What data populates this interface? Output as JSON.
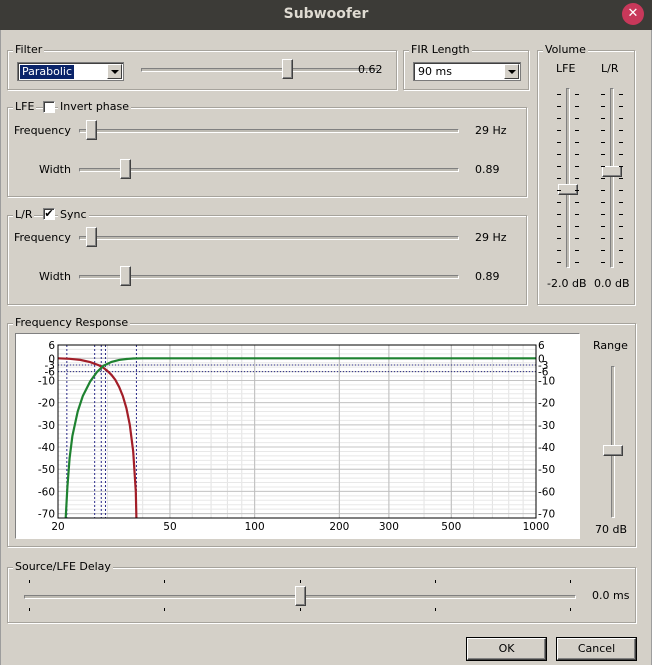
{
  "window": {
    "title": "Subwoofer",
    "close_glyph": "✕"
  },
  "filter": {
    "group_label": "Filter",
    "type_selected": "Parabolic",
    "slider_value": 0.62,
    "value_text": "0.62"
  },
  "fir": {
    "group_label": "FIR Length",
    "selected": "90 ms"
  },
  "lfe": {
    "group_label": "LFE",
    "invert_label": "Invert phase",
    "invert_checked": false,
    "freq_label": "Frequency",
    "freq_value_text": "29 Hz",
    "freq_fraction": 0.02,
    "width_label": "Width",
    "width_value_text": "0.89",
    "width_fraction": 0.11
  },
  "lr": {
    "group_label": "L/R",
    "sync_label": "Sync",
    "sync_checked": true,
    "sync_glyph": "✔",
    "freq_label": "Frequency",
    "freq_value_text": "29 Hz",
    "freq_fraction": 0.02,
    "width_label": "Width",
    "width_value_text": "0.89",
    "width_fraction": 0.11
  },
  "volume": {
    "group_label": "Volume",
    "lfe_label": "LFE",
    "lr_label": "L/R",
    "lfe_value_text": "-2.0 dB",
    "lr_value_text": "0.0 dB",
    "lfe_fraction": 0.57,
    "lr_fraction": 0.46
  },
  "freq_response": {
    "group_label": "Frequency Response",
    "range_label": "Range",
    "range_value_text": "70 dB",
    "range_fraction": 0.56,
    "colors": {
      "lowpass": "#a21e28",
      "highpass": "#1e8230",
      "marker": "#2a2a8a"
    },
    "chart_data": {
      "type": "line",
      "x_scale": "log",
      "xlim": [
        20,
        1000
      ],
      "ylim": [
        -72,
        6
      ],
      "x_ticks": [
        {
          "v": 20,
          "t": "20"
        },
        {
          "v": 50,
          "t": "50"
        },
        {
          "v": 100,
          "t": "100"
        },
        {
          "v": 200,
          "t": "200"
        },
        {
          "v": 300,
          "t": "300"
        },
        {
          "v": 500,
          "t": "500"
        },
        {
          "v": 1000,
          "t": "1000"
        }
      ],
      "y_ticks_left": [
        {
          "v": 6,
          "t": "6"
        },
        {
          "v": 0,
          "t": "0"
        },
        {
          "v": -3,
          "t": "-3"
        },
        {
          "v": -6,
          "t": "-6"
        },
        {
          "v": -10,
          "t": "-10"
        },
        {
          "v": -20,
          "t": "-20"
        },
        {
          "v": -30,
          "t": "-30"
        },
        {
          "v": -40,
          "t": "-40"
        },
        {
          "v": -50,
          "t": "-50"
        },
        {
          "v": -60,
          "t": "-60"
        },
        {
          "v": -70,
          "t": "-70"
        }
      ],
      "y_ticks_right": [
        {
          "v": 6,
          "t": "6"
        },
        {
          "v": 0,
          "t": "0"
        },
        {
          "v": -3,
          "t": "-3"
        },
        {
          "v": -6,
          "t": "-6"
        },
        {
          "v": -10,
          "t": "-10"
        },
        {
          "v": -20,
          "t": "-20"
        },
        {
          "v": -30,
          "t": "-30"
        },
        {
          "v": -40,
          "t": "-40"
        },
        {
          "v": -50,
          "t": "-50"
        },
        {
          "v": -60,
          "t": "-60"
        },
        {
          "v": -70,
          "t": "-70"
        }
      ],
      "markers_x": [
        21.5,
        27,
        28.5,
        29.5,
        38
      ],
      "series": [
        {
          "key": "lowpass",
          "x": [
            20,
            22,
            24,
            26,
            28,
            29,
            30,
            31,
            32,
            33,
            34,
            35,
            36,
            37,
            37.8,
            38
          ],
          "y": [
            0,
            -0.2,
            -0.7,
            -1.7,
            -3.2,
            -4.3,
            -5.7,
            -7.5,
            -9.8,
            -13,
            -17,
            -22.5,
            -30,
            -42,
            -60,
            -72
          ]
        },
        {
          "key": "highpass",
          "x": [
            21.3,
            21.6,
            22,
            22.5,
            23.5,
            24.5,
            26,
            27.5,
            29,
            31,
            33,
            35,
            37,
            40,
            45,
            60,
            100,
            1000
          ],
          "y": [
            -72,
            -58,
            -45,
            -35,
            -24,
            -17,
            -10.5,
            -6.2,
            -3.4,
            -1.6,
            -0.7,
            -0.3,
            -0.1,
            0,
            0,
            0,
            0,
            0
          ]
        }
      ]
    }
  },
  "delay": {
    "group_label": "Source/LFE Delay",
    "value_text": "0.0 ms",
    "fraction": 0.5
  },
  "buttons": {
    "ok": "OK",
    "cancel": "Cancel"
  }
}
